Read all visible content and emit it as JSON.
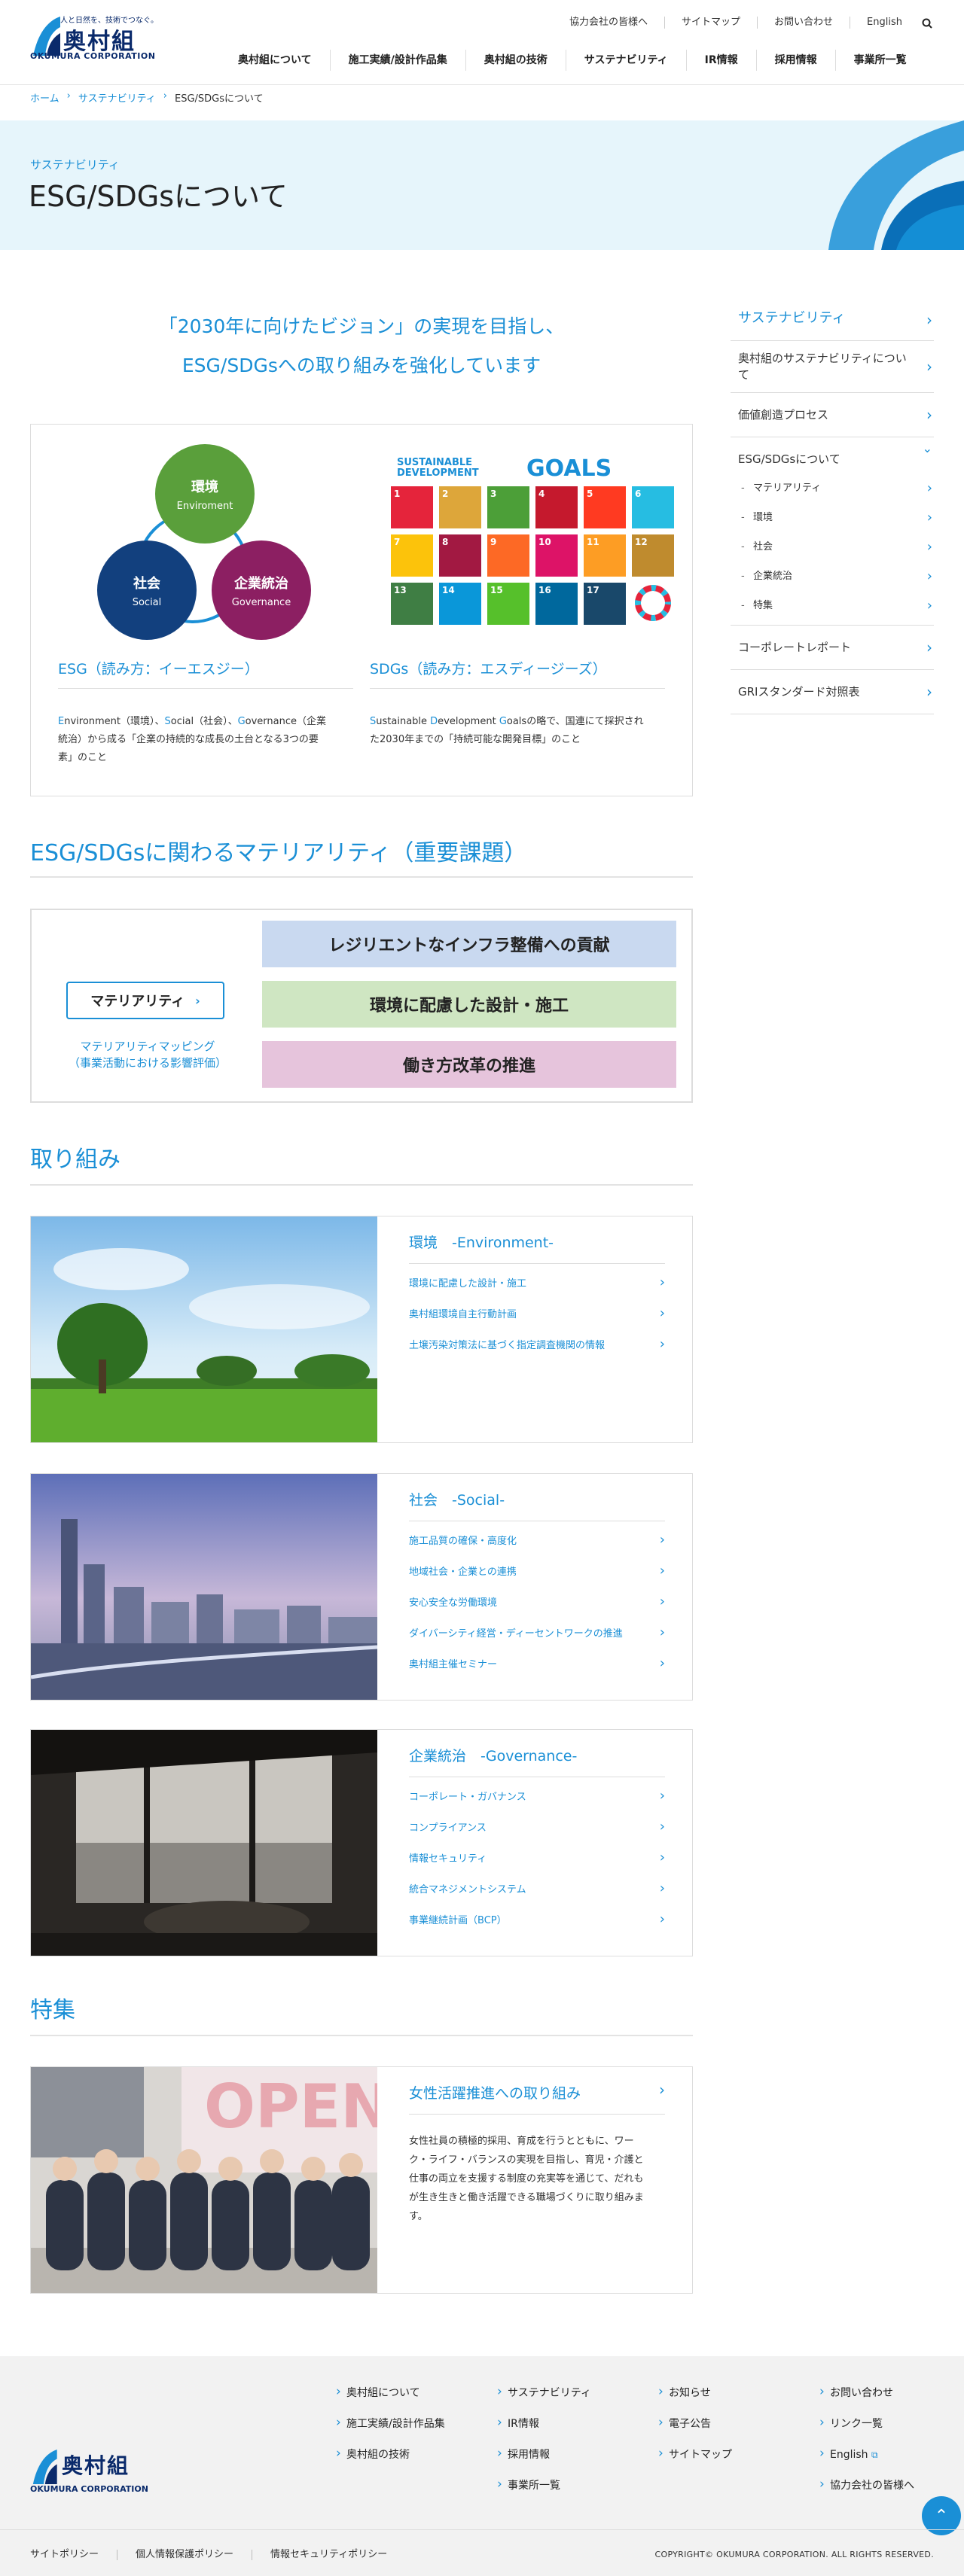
{
  "header": {
    "logo_tagline": "人と日然を、技術でつなぐ。",
    "logo_jp": "奥村組",
    "logo_en": "OKUMURA CORPORATION",
    "utility": [
      "協力会社の皆様へ",
      "サイトマップ",
      "お問い合わせ",
      "English"
    ],
    "nav": [
      "奥村組について",
      "施工実績/設計作品集",
      "奥村組の技術",
      "サステナビリティ",
      "IR情報",
      "採用情報",
      "事業所一覧"
    ]
  },
  "breadcrumb": [
    "ホーム",
    "サステナビリティ",
    "ESG/SDGsについて"
  ],
  "hero": {
    "subtitle": "サステナビリティ",
    "title": "ESG/SDGsについて"
  },
  "lead": [
    "「2030年に向けたビジョン」の実現を目指し、",
    "ESG/SDGsへの取り組みを強化しています"
  ],
  "esg": {
    "circles": [
      {
        "jp": "環境",
        "en": "Enviroment",
        "color": "#5a9f3b"
      },
      {
        "jp": "社会",
        "en": "Social",
        "color": "#12407e"
      },
      {
        "jp": "企業統治",
        "en": "Governance",
        "color": "#8c1f62"
      }
    ],
    "heading": "ESG（読み方：イーエスジー）",
    "desc_1a": "E",
    "desc_1b": "nvironment（環境）、",
    "desc_1c": "S",
    "desc_1d": "ocial（社会）、",
    "desc_1e": "G",
    "desc_1f": "overnance（企業",
    "desc_2": "統治）から成る「企業の持続的な成長の土台となる3つの要",
    "desc_3": "素」のこと"
  },
  "sdgs": {
    "logo_line1": "SUSTAINABLE",
    "logo_line2": "DEVELOPMENT",
    "logo_goals": "GOALS",
    "heading": "SDGs（読み方：エスディージーズ）",
    "desc_1a": "S",
    "desc_1b": "ustainable ",
    "desc_1c": "D",
    "desc_1d": "evelopment ",
    "desc_1e": "G",
    "desc_1f": "oalsの略で、国連にて採択され",
    "desc_2": "た2030年までの「持続可能な開発目標」のこと",
    "goals": [
      {
        "n": "1",
        "c": "#e5243b"
      },
      {
        "n": "2",
        "c": "#dda63a"
      },
      {
        "n": "3",
        "c": "#4c9f38"
      },
      {
        "n": "4",
        "c": "#c5192d"
      },
      {
        "n": "5",
        "c": "#ff3a21"
      },
      {
        "n": "6",
        "c": "#26bde2"
      },
      {
        "n": "7",
        "c": "#fcc30b"
      },
      {
        "n": "8",
        "c": "#a21942"
      },
      {
        "n": "9",
        "c": "#fd6925"
      },
      {
        "n": "10",
        "c": "#dd1367"
      },
      {
        "n": "11",
        "c": "#fd9d24"
      },
      {
        "n": "12",
        "c": "#bf8b2e"
      },
      {
        "n": "13",
        "c": "#3f7e44"
      },
      {
        "n": "14",
        "c": "#0a97d9"
      },
      {
        "n": "15",
        "c": "#56c02b"
      },
      {
        "n": "16",
        "c": "#00689d"
      },
      {
        "n": "17",
        "c": "#19486a"
      },
      {
        "n": "",
        "c": "#ffffff"
      }
    ]
  },
  "materiality": {
    "title": "ESG/SDGsに関わるマテリアリティ（重要課題）",
    "button": "マテリアリティ",
    "caption_1": "マテリアリティマッピング",
    "caption_2": "（事業活動における影響評価）",
    "bars": [
      {
        "label": "レジリエントなインフラ整備への貢献",
        "color": "#c9d9f0"
      },
      {
        "label": "環境に配慮した設計・施工",
        "color": "#cfe6c2"
      },
      {
        "label": "働き方改革の推進",
        "color": "#e6c4dc"
      }
    ]
  },
  "torikumi": {
    "title": "取り組み",
    "cards": [
      {
        "heading": "環境　-Environment-",
        "links": [
          "環境に配慮した設計・施工",
          "奥村組環境自主行動計画",
          "土壌汚染対策法に基づく指定調査機関の情報"
        ]
      },
      {
        "heading": "社会　-Social-",
        "links": [
          "施工品質の確保・高度化",
          "地域社会・企業との連携",
          "安心安全な労働環境",
          "ダイバーシティ経営・ディーセントワークの推進",
          "奥村組主催セミナー"
        ]
      },
      {
        "heading": "企業統治　-Governance-",
        "links": [
          "コーポレート・ガバナンス",
          "コンプライアンス",
          "情報セキュリティ",
          "統合マネジメントシステム",
          "事業継続計画（BCP）"
        ]
      }
    ]
  },
  "tokushu": {
    "title": "特集",
    "heading": "女性活躍推進への取り組み",
    "sign_text": "OPEN",
    "body": [
      "女性社員の積極的採用、育成を行うとともに、ワー",
      "ク・ライフ・バランスの実現を目指し、育児・介護と",
      "仕事の両立を支援する制度の充実等を通じて、だれも",
      "が生き生きと働き活躍できる職場づくりに取り組みま",
      "す。"
    ]
  },
  "sidebar": {
    "top": "サステナビリティ",
    "items": [
      "奥村組のサステナビリティについて",
      "価値創造プロセス"
    ],
    "open": "ESG/SDGsについて",
    "subs": [
      "マテリアリティ",
      "環境",
      "社会",
      "企業統治",
      "特集"
    ],
    "after": [
      "コーポレートレポート",
      "GRIスタンダード対照表"
    ]
  },
  "footer": {
    "col1": [
      "奥村組について",
      "施工実績/設計作品集",
      "奥村組の技術"
    ],
    "col2": [
      "サステナビリティ",
      "IR情報",
      "採用情報",
      "事業所一覧"
    ],
    "col3": [
      "お知らせ",
      "電子公告",
      "サイトマップ"
    ],
    "col4": [
      "お問い合わせ",
      "リンク一覧",
      "English",
      "協力会社の皆様へ"
    ],
    "bottom_links": [
      "サイトポリシー",
      "個人情報保護ポリシー",
      "情報セキュリティポリシー"
    ],
    "copyright": "COPYRIGHT© OKUMURA CORPORATION. ALL RIGHTS RESERVED."
  }
}
